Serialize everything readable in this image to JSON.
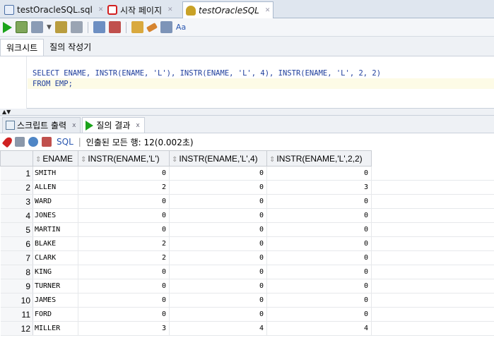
{
  "doc_tabs": [
    {
      "label": "testOracleSQL.sql",
      "icon": "sql-file-icon"
    },
    {
      "label": "시작 페이지",
      "icon": "start-page-icon"
    },
    {
      "label": "testOracleSQL",
      "icon": "db-connection-icon"
    }
  ],
  "worksheet_tabs": {
    "worksheet": "워크시트",
    "query_builder": "질의 작성기"
  },
  "editor": {
    "line1": "SELECT ENAME, INSTR(ENAME, 'L'), INSTR(ENAME, 'L', 4), INSTR(ENAME, 'L', 2, 2)",
    "line2": "FROM EMP;"
  },
  "result_tabs": {
    "script_output": "스크립트 출력",
    "query_result": "질의 결과",
    "close": "x"
  },
  "result_toolbar": {
    "sql": "SQL",
    "status": "인출된 모든 행: 12(0.002초)"
  },
  "grid": {
    "columns": [
      "ENAME",
      "INSTR(ENAME,'L')",
      "INSTR(ENAME,'L',4)",
      "INSTR(ENAME,'L',2,2)"
    ],
    "rows": [
      {
        "n": "1",
        "ename": "SMITH",
        "c1": "0",
        "c2": "0",
        "c3": "0"
      },
      {
        "n": "2",
        "ename": "ALLEN",
        "c1": "2",
        "c2": "0",
        "c3": "3"
      },
      {
        "n": "3",
        "ename": "WARD",
        "c1": "0",
        "c2": "0",
        "c3": "0"
      },
      {
        "n": "4",
        "ename": "JONES",
        "c1": "0",
        "c2": "0",
        "c3": "0"
      },
      {
        "n": "5",
        "ename": "MARTIN",
        "c1": "0",
        "c2": "0",
        "c3": "0"
      },
      {
        "n": "6",
        "ename": "BLAKE",
        "c1": "2",
        "c2": "0",
        "c3": "0"
      },
      {
        "n": "7",
        "ename": "CLARK",
        "c1": "2",
        "c2": "0",
        "c3": "0"
      },
      {
        "n": "8",
        "ename": "KING",
        "c1": "0",
        "c2": "0",
        "c3": "0"
      },
      {
        "n": "9",
        "ename": "TURNER",
        "c1": "0",
        "c2": "0",
        "c3": "0"
      },
      {
        "n": "10",
        "ename": "JAMES",
        "c1": "0",
        "c2": "0",
        "c3": "0"
      },
      {
        "n": "11",
        "ename": "FORD",
        "c1": "0",
        "c2": "0",
        "c3": "0"
      },
      {
        "n": "12",
        "ename": "MILLER",
        "c1": "3",
        "c2": "4",
        "c3": "4"
      }
    ]
  }
}
